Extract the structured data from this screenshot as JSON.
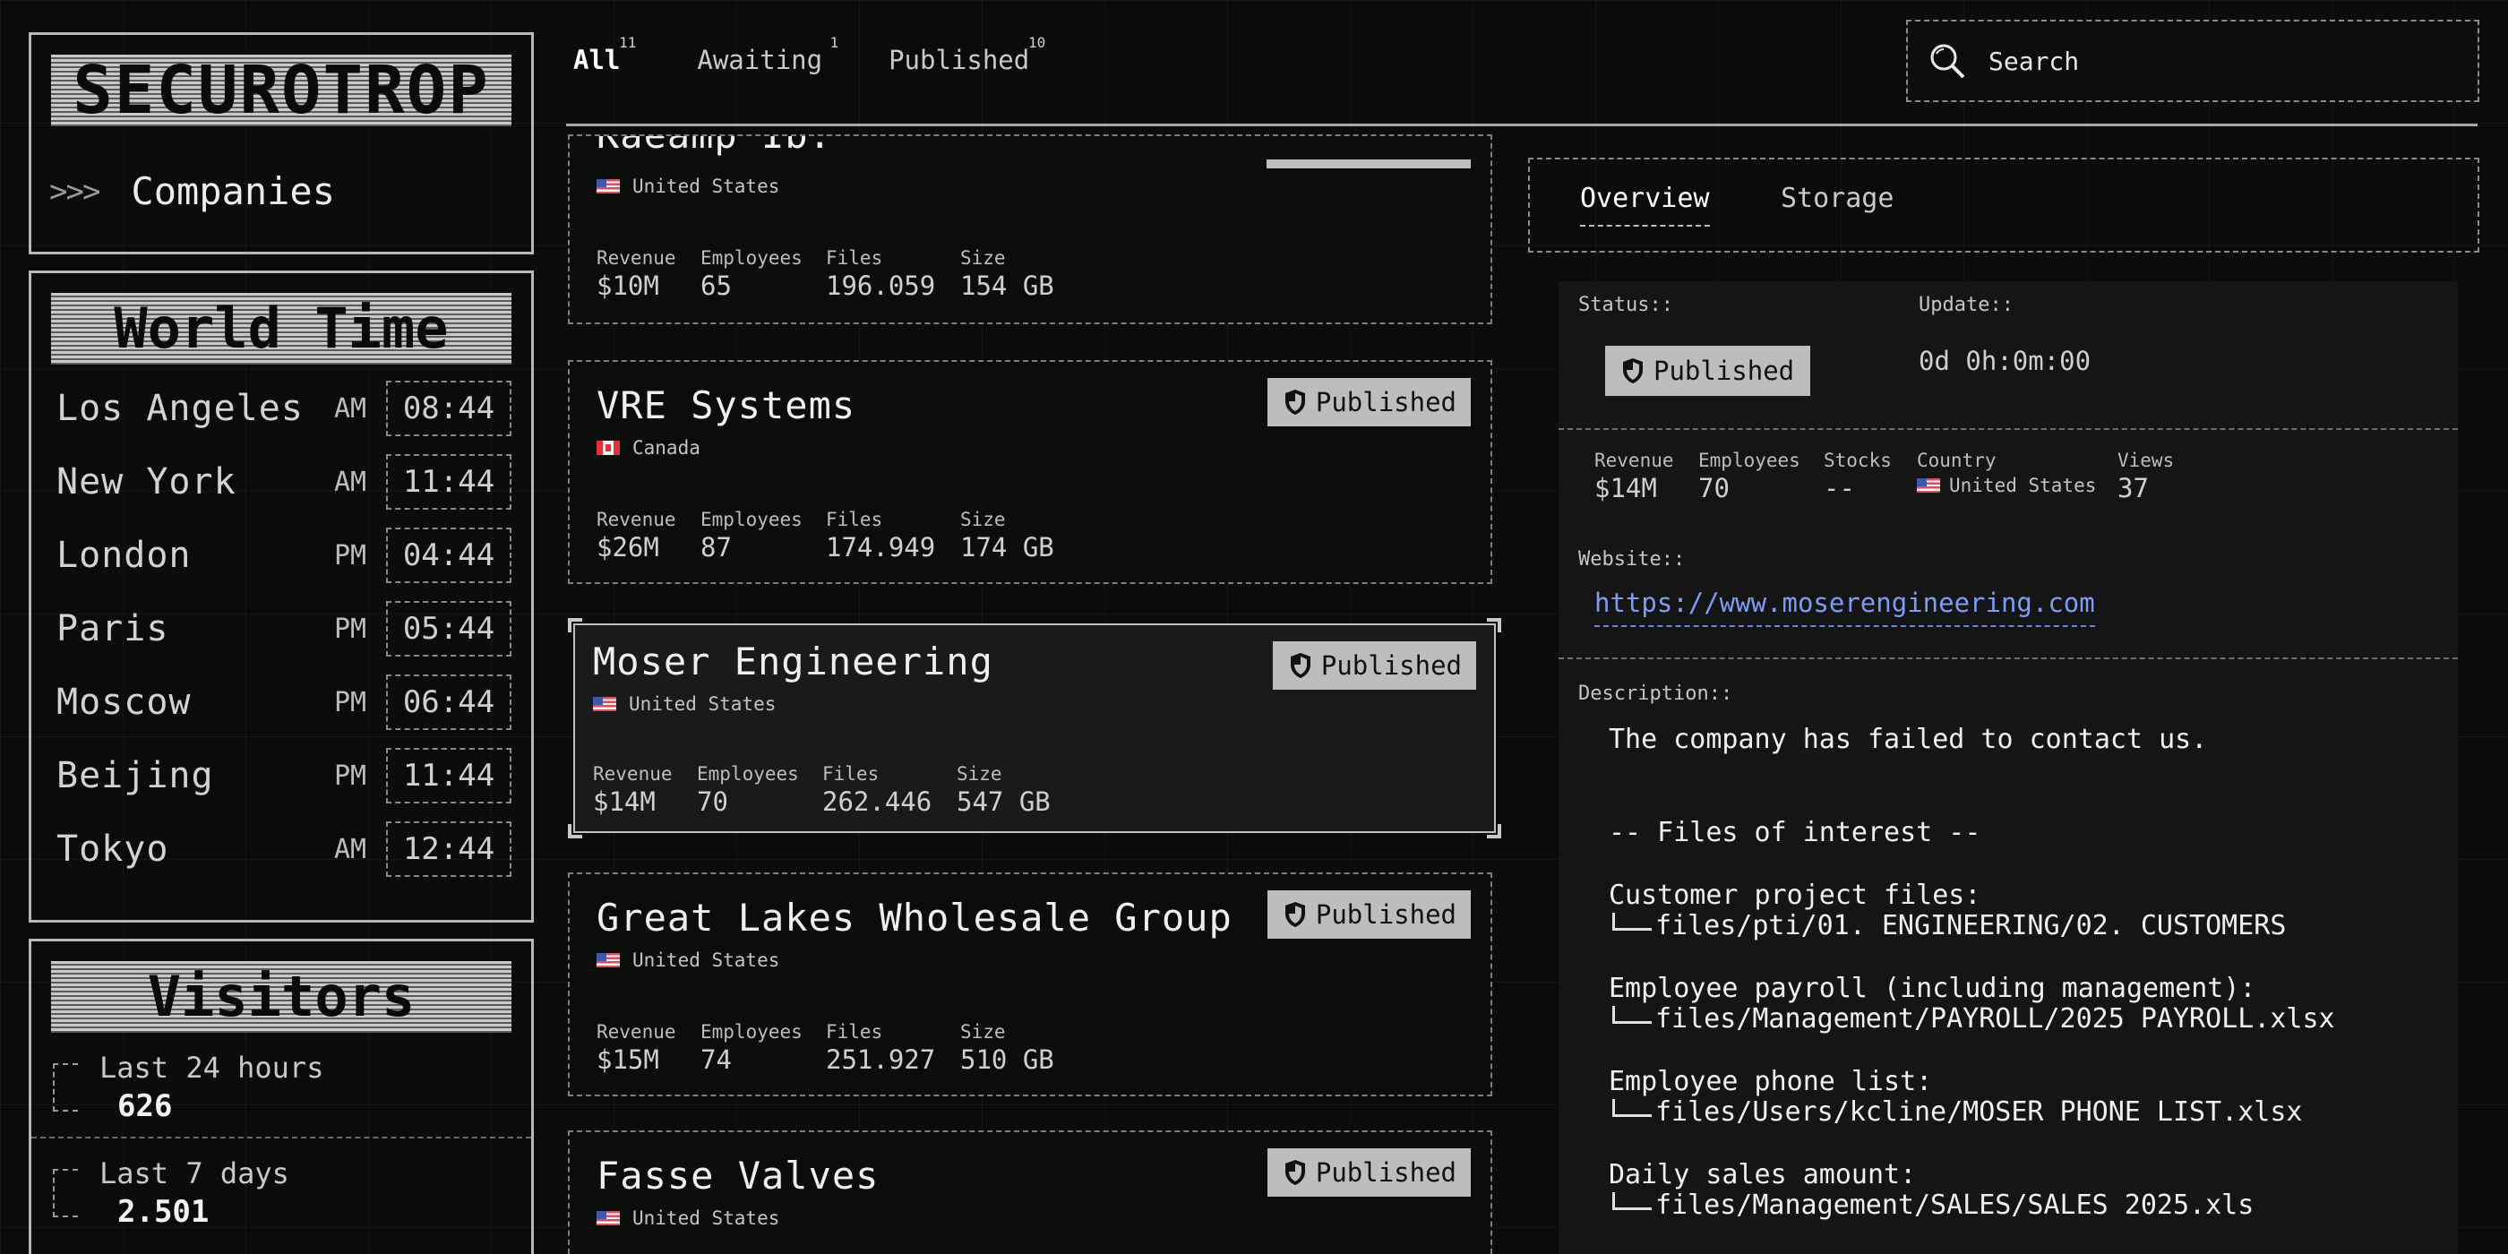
{
  "app": {
    "logo": "SECUROTROP",
    "nav": {
      "chevrons": ">>>",
      "label": "Companies"
    }
  },
  "world_time": {
    "title": "World Time",
    "rows": [
      {
        "city": "Los Angeles",
        "ampm": "AM",
        "time": "08:44"
      },
      {
        "city": "New York",
        "ampm": "AM",
        "time": "11:44"
      },
      {
        "city": "London",
        "ampm": "PM",
        "time": "04:44"
      },
      {
        "city": "Paris",
        "ampm": "PM",
        "time": "05:44"
      },
      {
        "city": "Moscow",
        "ampm": "PM",
        "time": "06:44"
      },
      {
        "city": "Beijing",
        "ampm": "PM",
        "time": "11:44"
      },
      {
        "city": "Tokyo",
        "ampm": "AM",
        "time": "12:44"
      }
    ]
  },
  "visitors": {
    "title": "Visitors",
    "rows": [
      {
        "label": "Last 24 hours",
        "count": "626"
      },
      {
        "label": "Last 7 days",
        "count": "2.501"
      }
    ]
  },
  "tabs": [
    {
      "label": "All",
      "count": "11",
      "active": true
    },
    {
      "label": "Awaiting",
      "count": "1",
      "active": false
    },
    {
      "label": "Published",
      "count": "10",
      "active": false
    }
  ],
  "search": {
    "placeholder": "Search",
    "value": ""
  },
  "stat_labels": {
    "revenue": "Revenue",
    "employees": "Employees",
    "files": "Files",
    "size": "Size"
  },
  "companies": [
    {
      "name": "Kaeamp Ib.",
      "country": "United States",
      "flag": "us",
      "revenue": "$10M",
      "employees": "65",
      "files": "196.059",
      "size": "154 GB"
    },
    {
      "name": "VRE Systems",
      "country": "Canada",
      "flag": "ca",
      "badge": "Published",
      "revenue": "$26M",
      "employees": "87",
      "files": "174.949",
      "size": "174 GB"
    },
    {
      "name": "Moser Engineering",
      "country": "United States",
      "flag": "us",
      "badge": "Published",
      "revenue": "$14M",
      "employees": "70",
      "files": "262.446",
      "size": "547 GB",
      "selected": true
    },
    {
      "name": "Great Lakes Wholesale Group",
      "country": "United States",
      "flag": "us",
      "badge": "Published",
      "revenue": "$15M",
      "employees": "74",
      "files": "251.927",
      "size": "510 GB"
    },
    {
      "name": "Fasse Valves",
      "country": "United States",
      "flag": "us",
      "badge": "Published"
    }
  ],
  "detail": {
    "tabs": [
      "Overview",
      "Storage"
    ],
    "status_label": "Status::",
    "status_value": "Published",
    "update_label": "Update::",
    "update_value": "0d 0h:0m:00",
    "stats": [
      {
        "label": "Revenue",
        "value": "$14M"
      },
      {
        "label": "Employees",
        "value": "70"
      },
      {
        "label": "Stocks",
        "value": "--"
      },
      {
        "label": "Country",
        "value": "United States"
      },
      {
        "label": "Views",
        "value": "37"
      }
    ],
    "website_label": "Website::",
    "website": "https://www.moserengineering.com",
    "description_label": "Description::",
    "description": [
      "The company has failed to contact us.",
      "-- Files of interest --",
      "Customer project files:",
      "files/pti/01. ENGINEERING/02. CUSTOMERS",
      "Employee payroll (including management):",
      "files/Management/PAYROLL/2025 PAYROLL.xlsx",
      "Employee phone list:",
      "files/Users/kcline/MOSER PHONE LIST.xlsx",
      "Daily sales amount:",
      "files/Management/SALES/SALES 2025.xls"
    ]
  },
  "colors": {
    "background": "#0a0c0a",
    "badge": "#bdbdbd",
    "link": "#7f9cf5"
  }
}
